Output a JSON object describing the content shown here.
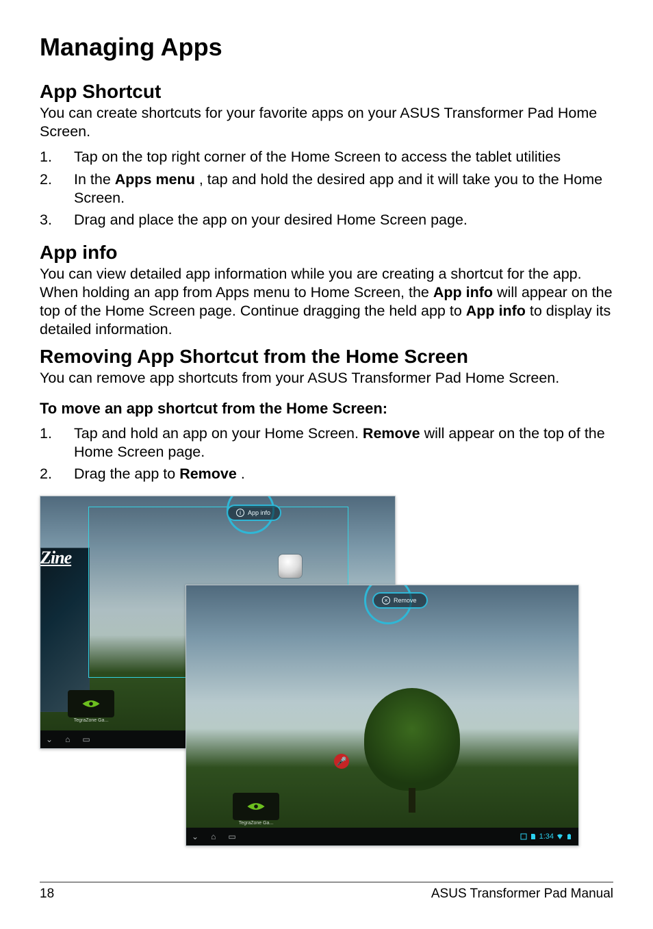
{
  "headings": {
    "h1": "Managing Apps",
    "h2_shortcut": "App Shortcut",
    "h2_info": "App info",
    "h2_remove": "Removing App Shortcut from the Home Screen",
    "h3_move": "To move an app shortcut from the Home Screen:"
  },
  "paragraphs": {
    "shortcut_intro": "You can create shortcuts for your favorite apps on your ASUS Transformer Pad Home Screen.",
    "info_p1a": "You can view detailed app information while you are creating a shortcut for the app. When holding an app from Apps menu to Home Screen, the ",
    "info_b1": "App info",
    "info_p1b": " will appear on the top of the Home Screen page. Continue dragging the held app to ",
    "info_b2": "App info",
    "info_p1c": " to display its detailed information.",
    "remove_intro": "You can remove app shortcuts from your ASUS Transformer Pad Home Screen."
  },
  "list_shortcut": [
    {
      "pre": "Tap on the top right corner of the Home Screen to access the tablet utilities",
      "b": "",
      "post": ""
    },
    {
      "pre": "In the ",
      "b": "Apps menu",
      "post": ", tap and hold the desired app and it will take you to the Home Screen."
    },
    {
      "pre": "Drag and place the app on your desired Home Screen page.",
      "b": "",
      "post": ""
    }
  ],
  "list_remove": [
    {
      "pre": "Tap and hold an app on your Home Screen. ",
      "b": "Remove",
      "post": " will appear on the top of the Home Screen page."
    },
    {
      "pre": "Drag the app to ",
      "b": "Remove",
      "post": "."
    }
  ],
  "screenshot": {
    "badge_info_icon": "i",
    "badge_info_label": "App info",
    "badge_remove_icon": "×",
    "badge_remove_label": "Remove",
    "widget_label": "TegraZone Ga...",
    "zine_title": "Zine",
    "clock": "1:34",
    "mic": "🎤"
  },
  "footer": {
    "page": "18",
    "manual": "ASUS Transformer Pad Manual"
  }
}
